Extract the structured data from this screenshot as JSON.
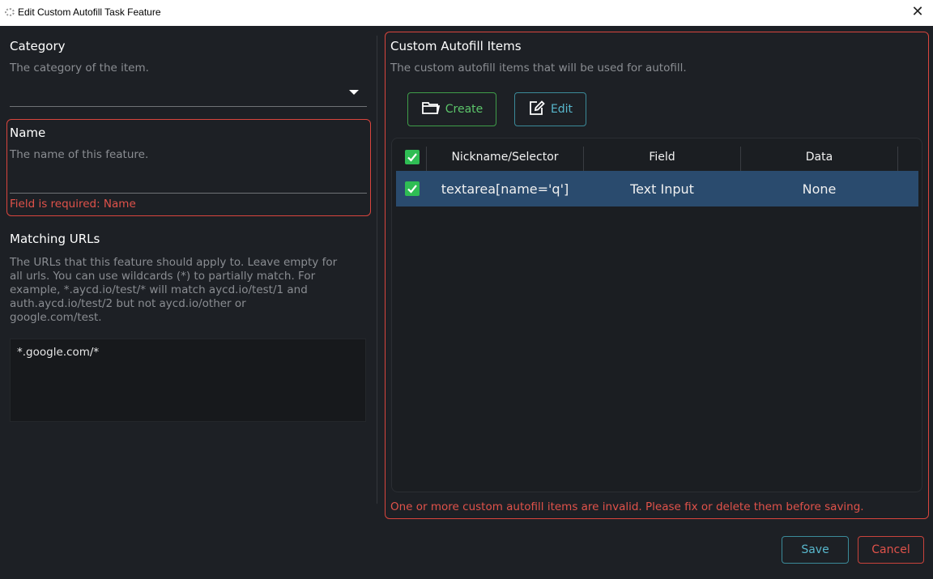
{
  "window": {
    "title": "Edit Custom Autofill Task Feature",
    "close_glyph": "✕"
  },
  "category": {
    "label": "Category",
    "description": "The category of the item.",
    "value": ""
  },
  "name": {
    "label": "Name",
    "description": "The name of this feature.",
    "value": "",
    "error": "Field is required: Name"
  },
  "matching_urls": {
    "label": "Matching URLs",
    "description_lines": [
      "The URLs that this feature should apply to. Leave empty for",
      "all urls. You can use wildcards (*) to partially match. For",
      "example, *.aycd.io/test/* will match aycd.io/test/1 and",
      "auth.aycd.io/test/2 but not aycd.io/other or",
      "google.com/test."
    ],
    "value": "*.google.com/*"
  },
  "custom_items": {
    "label": "Custom Autofill Items",
    "description": "The custom autofill items that will be used for autofill.",
    "create_label": "Create",
    "edit_label": "Edit",
    "columns": [
      "Nickname/Selector",
      "Field",
      "Data"
    ],
    "rows": [
      {
        "checked": true,
        "selector": "textarea[name='q']",
        "field": "Text Input",
        "data": "None"
      }
    ],
    "error": "One or more custom autofill items are invalid. Please fix or delete them before saving."
  },
  "footer": {
    "save_label": "Save",
    "cancel_label": "Cancel"
  },
  "colors": {
    "error": "#e0524a",
    "create_accent": "#5cc56a",
    "edit_accent": "#58b7cc",
    "selected_row": "#2a4b6e",
    "checkbox": "#2fbd54"
  }
}
